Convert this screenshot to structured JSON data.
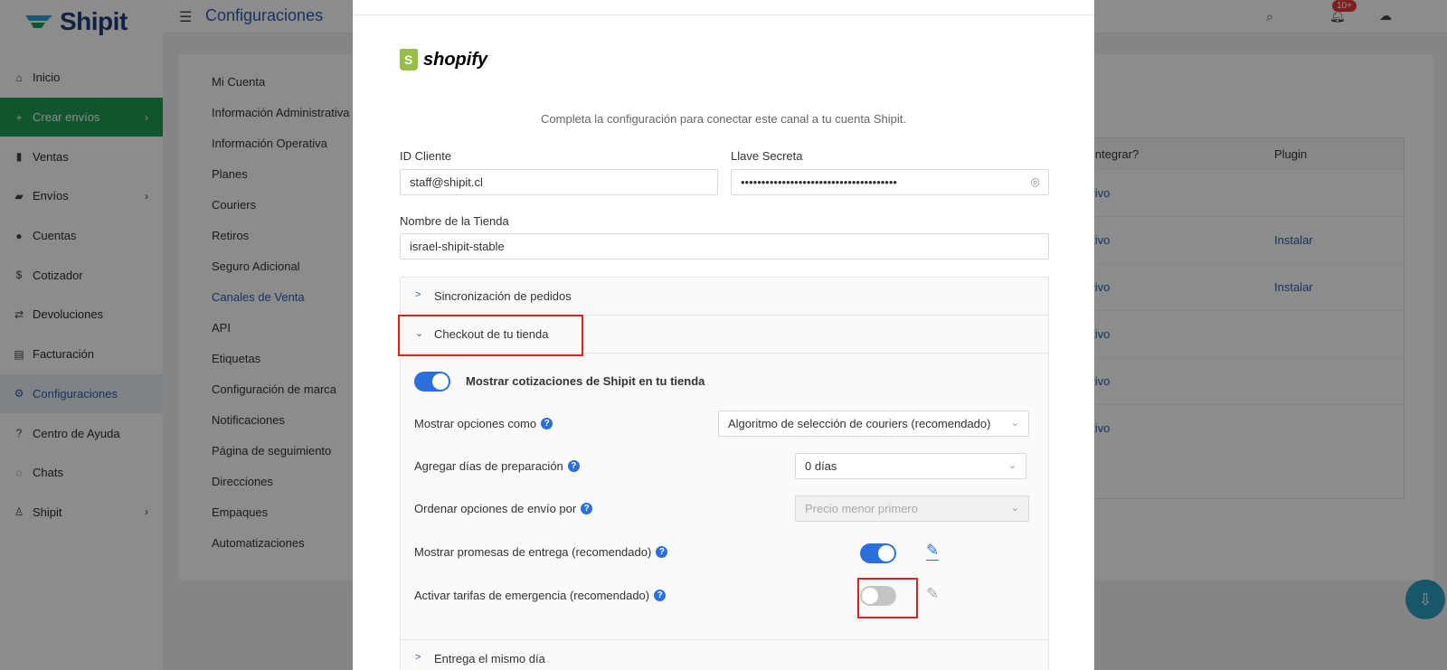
{
  "app": {
    "brand": "Shipit",
    "page_title": "Configuraciones",
    "notif_badge": "10+"
  },
  "sidebar": {
    "items": [
      {
        "label": "Inicio",
        "icon": "home-icon",
        "glyph": "⌂"
      },
      {
        "label": "Crear envíos",
        "icon": "plus-icon",
        "glyph": "+"
      },
      {
        "label": "Ventas",
        "icon": "sales-icon",
        "glyph": "▮"
      },
      {
        "label": "Envíos",
        "icon": "truck-icon",
        "glyph": "▰"
      },
      {
        "label": "Cuentas",
        "icon": "users-icon",
        "glyph": "●"
      },
      {
        "label": "Cotizador",
        "icon": "dollar-icon",
        "glyph": "$"
      },
      {
        "label": "Devoluciones",
        "icon": "return-icon",
        "glyph": "⇄"
      },
      {
        "label": "Facturación",
        "icon": "invoice-icon",
        "glyph": "▤"
      },
      {
        "label": "Configuraciones",
        "icon": "gear-icon",
        "glyph": "⚙"
      },
      {
        "label": "Centro de Ayuda",
        "icon": "question-icon",
        "glyph": "?"
      },
      {
        "label": "Chats",
        "icon": "chat-icon",
        "glyph": "◌"
      },
      {
        "label": "Shipit",
        "icon": "user-icon",
        "glyph": "♙"
      }
    ]
  },
  "settings_nav": [
    "Mi Cuenta",
    "Información Administrativa",
    "Información Operativa",
    "Planes",
    "Couriers",
    "Retiros",
    "Seguro Adicional",
    "Canales de Venta",
    "API",
    "Etiquetas",
    "Configuración de marca",
    "Notificaciones",
    "Página de seguimiento",
    "Direcciones",
    "Empaques",
    "Automatizaciones"
  ],
  "bg_table": {
    "headers": [
      "ómo integrar?",
      "Plugin"
    ],
    "rows": [
      {
        "integrar": "structivo",
        "plugin": ""
      },
      {
        "integrar": "structivo",
        "plugin": "Instalar"
      },
      {
        "integrar": "structivo",
        "plugin": "Instalar"
      },
      {
        "integrar": "structivo",
        "plugin": ""
      },
      {
        "integrar": "structivo",
        "plugin": ""
      },
      {
        "integrar": "structivo",
        "plugin": ""
      }
    ]
  },
  "modal": {
    "logo_text": "shopify",
    "intro": "Completa la configuración para conectar este canal a tu cuenta Shipit.",
    "client_id_label": "ID Cliente",
    "client_id_value": "staff@shipit.cl",
    "secret_label": "Llave Secreta",
    "secret_value": "••••••••••••••••••••••••••••••••••••••",
    "store_label": "Nombre de la Tienda",
    "store_value": "israel-shipit-stable",
    "panels": {
      "sync": "Sincronización de pedidos",
      "checkout": "Checkout de tu tienda",
      "same_day": "Entrega el mismo día"
    },
    "checkout": {
      "show_quotes_label": "Mostrar cotizaciones de Shipit en tu tienda",
      "show_quotes_on": true,
      "show_options_label": "Mostrar opciones como",
      "show_options_value": "Algoritmo de selección de couriers (recomendado)",
      "prep_days_label": "Agregar días de preparación",
      "prep_days_value": "0 días",
      "order_by_label": "Ordenar opciones de envío por",
      "order_by_value": "Precio menor primero",
      "promises_label": "Mostrar promesas de entrega (recomendado)",
      "promises_on": true,
      "emergency_label": "Activar tarifas de emergencia (recomendado)",
      "emergency_on": false
    }
  }
}
